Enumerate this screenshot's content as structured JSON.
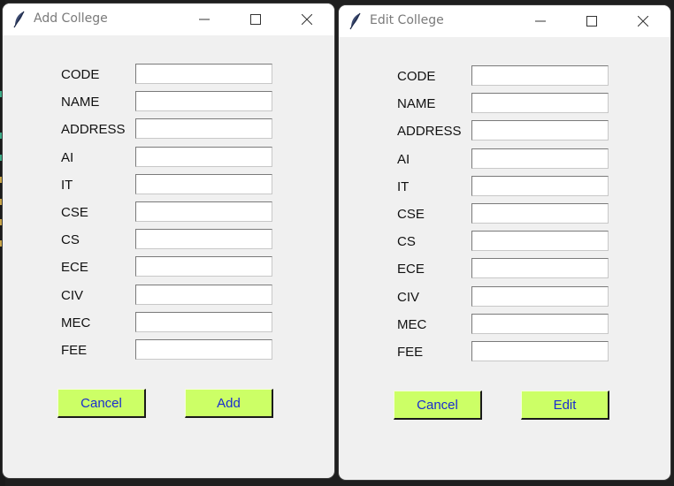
{
  "windows": [
    {
      "title": "Add College",
      "fields": [
        {
          "label": "CODE",
          "value": ""
        },
        {
          "label": "NAME",
          "value": ""
        },
        {
          "label": "ADDRESS",
          "value": ""
        },
        {
          "label": "AI",
          "value": ""
        },
        {
          "label": "IT",
          "value": ""
        },
        {
          "label": "CSE",
          "value": ""
        },
        {
          "label": "CS",
          "value": ""
        },
        {
          "label": "ECE",
          "value": ""
        },
        {
          "label": "CIV",
          "value": ""
        },
        {
          "label": "MEC",
          "value": ""
        },
        {
          "label": "FEE",
          "value": ""
        }
      ],
      "cancel_label": "Cancel",
      "primary_label": "Add"
    },
    {
      "title": "Edit College",
      "fields": [
        {
          "label": "CODE",
          "value": ""
        },
        {
          "label": "NAME",
          "value": ""
        },
        {
          "label": "ADDRESS",
          "value": ""
        },
        {
          "label": "AI",
          "value": ""
        },
        {
          "label": "IT",
          "value": ""
        },
        {
          "label": "CSE",
          "value": ""
        },
        {
          "label": "CS",
          "value": ""
        },
        {
          "label": "ECE",
          "value": ""
        },
        {
          "label": "CIV",
          "value": ""
        },
        {
          "label": "MEC",
          "value": ""
        },
        {
          "label": "FEE",
          "value": ""
        }
      ],
      "cancel_label": "Cancel",
      "primary_label": "Edit"
    }
  ],
  "icons": {
    "app": "feather-icon",
    "minimize": "minimize-icon",
    "maximize": "maximize-icon",
    "close": "close-icon"
  },
  "colors": {
    "button_bg": "#ccff66",
    "button_text": "#1a2bd0",
    "window_bg": "#f0f0f0",
    "titlebar_bg": "#ffffff",
    "title_text": "#7a7a7a"
  }
}
